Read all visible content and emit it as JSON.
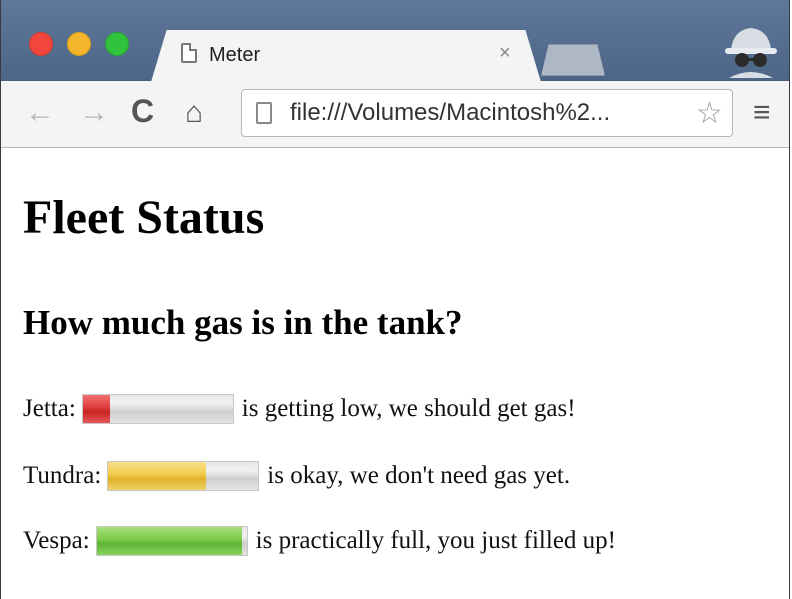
{
  "browser": {
    "tab_title": "Meter",
    "tab_close": "×",
    "address": "file:///Volumes/Macintosh%2...",
    "nav": {
      "back": "←",
      "forward": "→",
      "reload": "C",
      "home": "⌂",
      "star": "☆",
      "menu": "≡"
    },
    "colors": {
      "close": "#f2453e",
      "minimize": "#f5b52b",
      "maximize": "#30c33b"
    }
  },
  "page": {
    "heading": "Fleet Status",
    "subheading": "How much gas is in the tank?",
    "vehicles": [
      {
        "name": "Jetta:",
        "level": 0.18,
        "color": "red",
        "message": "is getting low, we should get gas!"
      },
      {
        "name": "Tundra:",
        "level": 0.65,
        "color": "yellow",
        "message": "is okay, we don't need gas yet."
      },
      {
        "name": "Vespa:",
        "level": 0.97,
        "color": "green",
        "message": "is practically full, you just filled up!"
      }
    ]
  }
}
